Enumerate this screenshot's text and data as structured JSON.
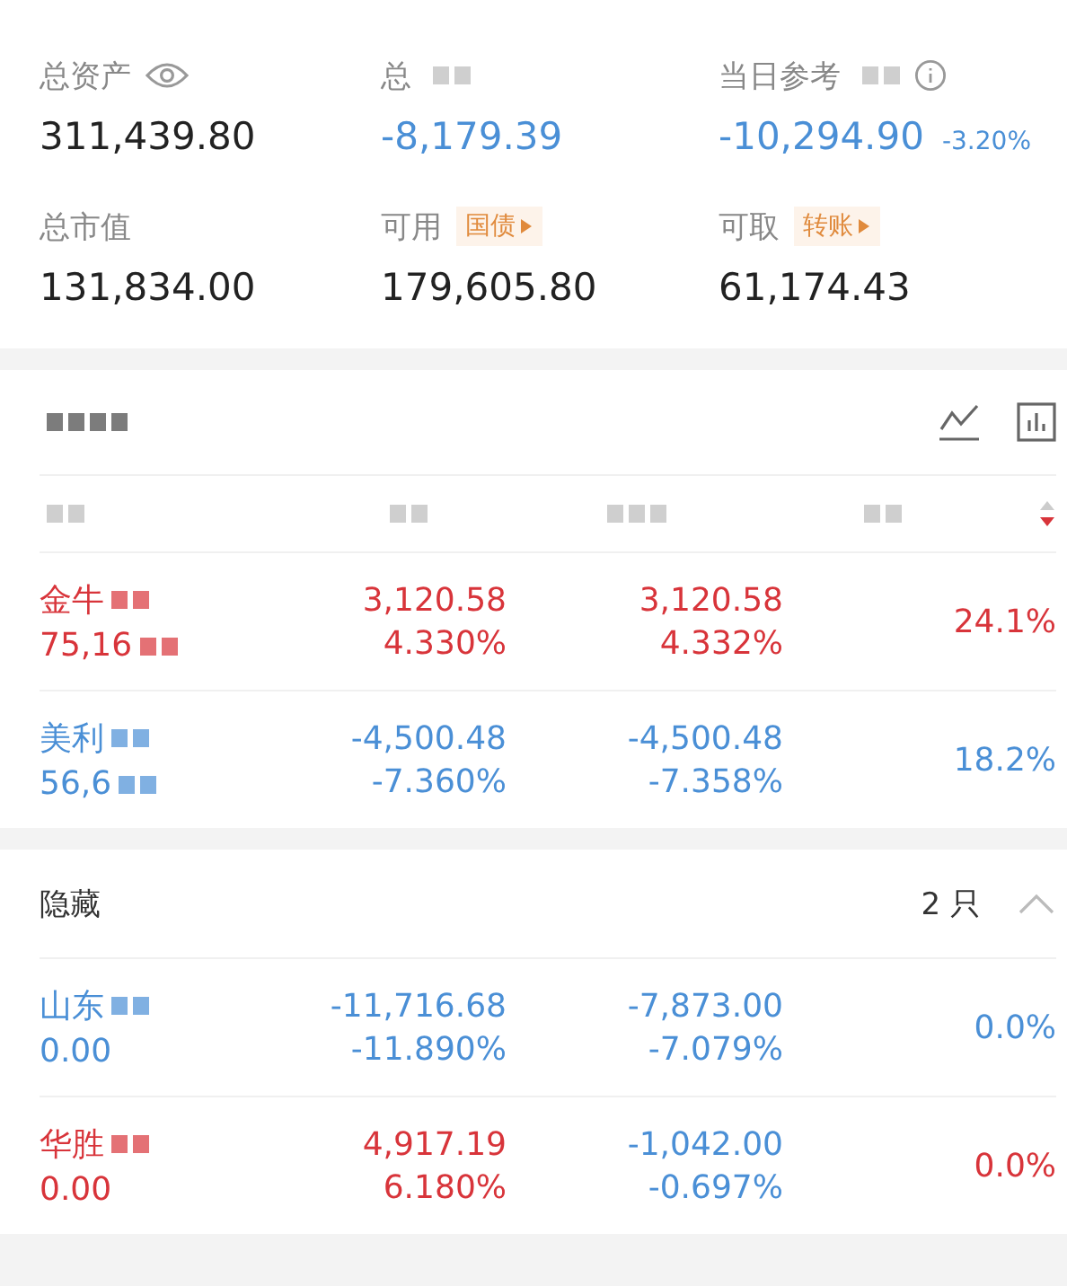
{
  "summary": [
    {
      "label": "总资产",
      "value": "311,439.80",
      "color": "#222222"
    },
    {
      "label": "总",
      "value": "-8,179.39",
      "color": "#4a8fd6"
    },
    {
      "label": "当日参考",
      "value": "-10,294.90",
      "extra": "-3.20%",
      "color": "#4a8fd6"
    },
    {
      "label": "总市值",
      "value": "131,834.00",
      "color": "#222222"
    },
    {
      "label": "可用",
      "badge": "国债",
      "value": "179,605.80",
      "color": "#222222"
    },
    {
      "label": "可取",
      "badge": "转账",
      "value": "61,174.43",
      "color": "#222222"
    }
  ],
  "holdings": [
    {
      "name": "金牛",
      "sub": "75,16",
      "color": "#d8343a",
      "profit": "3,120.58",
      "profit_pct": "4.330%",
      "today": {
        "value": "3,120.58",
        "pct": "4.332%",
        "color": "#d8343a"
      },
      "share": "24.1%"
    },
    {
      "name": "美利",
      "sub": "56,6",
      "color": "#4a8fd6",
      "profit": "-4,500.48",
      "profit_pct": "-7.360%",
      "today": {
        "value": "-4,500.48",
        "pct": "-7.358%",
        "color": "#4a8fd6"
      },
      "share": "18.2%"
    }
  ],
  "hidden": {
    "title": "隐藏",
    "count": "2 只",
    "expanded": true,
    "rows": [
      {
        "name": "山东",
        "sub": "0.00",
        "color": "#4a8fd6",
        "profit": "-11,716.68",
        "profit_pct": "-11.890%",
        "today": {
          "value": "-7,873.00",
          "pct": "-7.079%",
          "color": "#4a8fd6"
        },
        "share": "0.0%"
      },
      {
        "name": "华胜",
        "sub": "0.00",
        "color": "#d8343a",
        "profit": "4,917.19",
        "profit_pct": "6.180%",
        "today": {
          "value": "-1,042.00",
          "pct": "-0.697%",
          "color": "#4a8fd6"
        },
        "share": "0.0%"
      }
    ]
  }
}
